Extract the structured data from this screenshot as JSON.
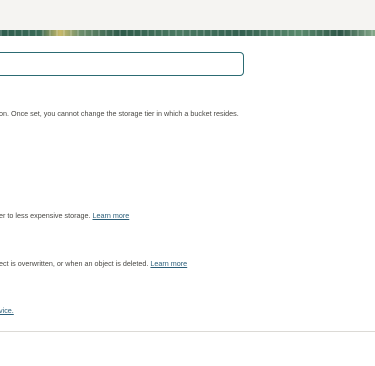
{
  "storage_tier": {
    "help_text": "on. Once set, you cannot change the storage tier in which a bucket resides."
  },
  "auto_tiering": {
    "help_text": "er to less expensive storage.",
    "learn_more": "Learn more"
  },
  "versioning": {
    "help_text": "ect is overwritten, or when an object is deleted.",
    "learn_more": "Learn more"
  },
  "service_link": {
    "label": "vice."
  },
  "name_input": {
    "value": ""
  }
}
